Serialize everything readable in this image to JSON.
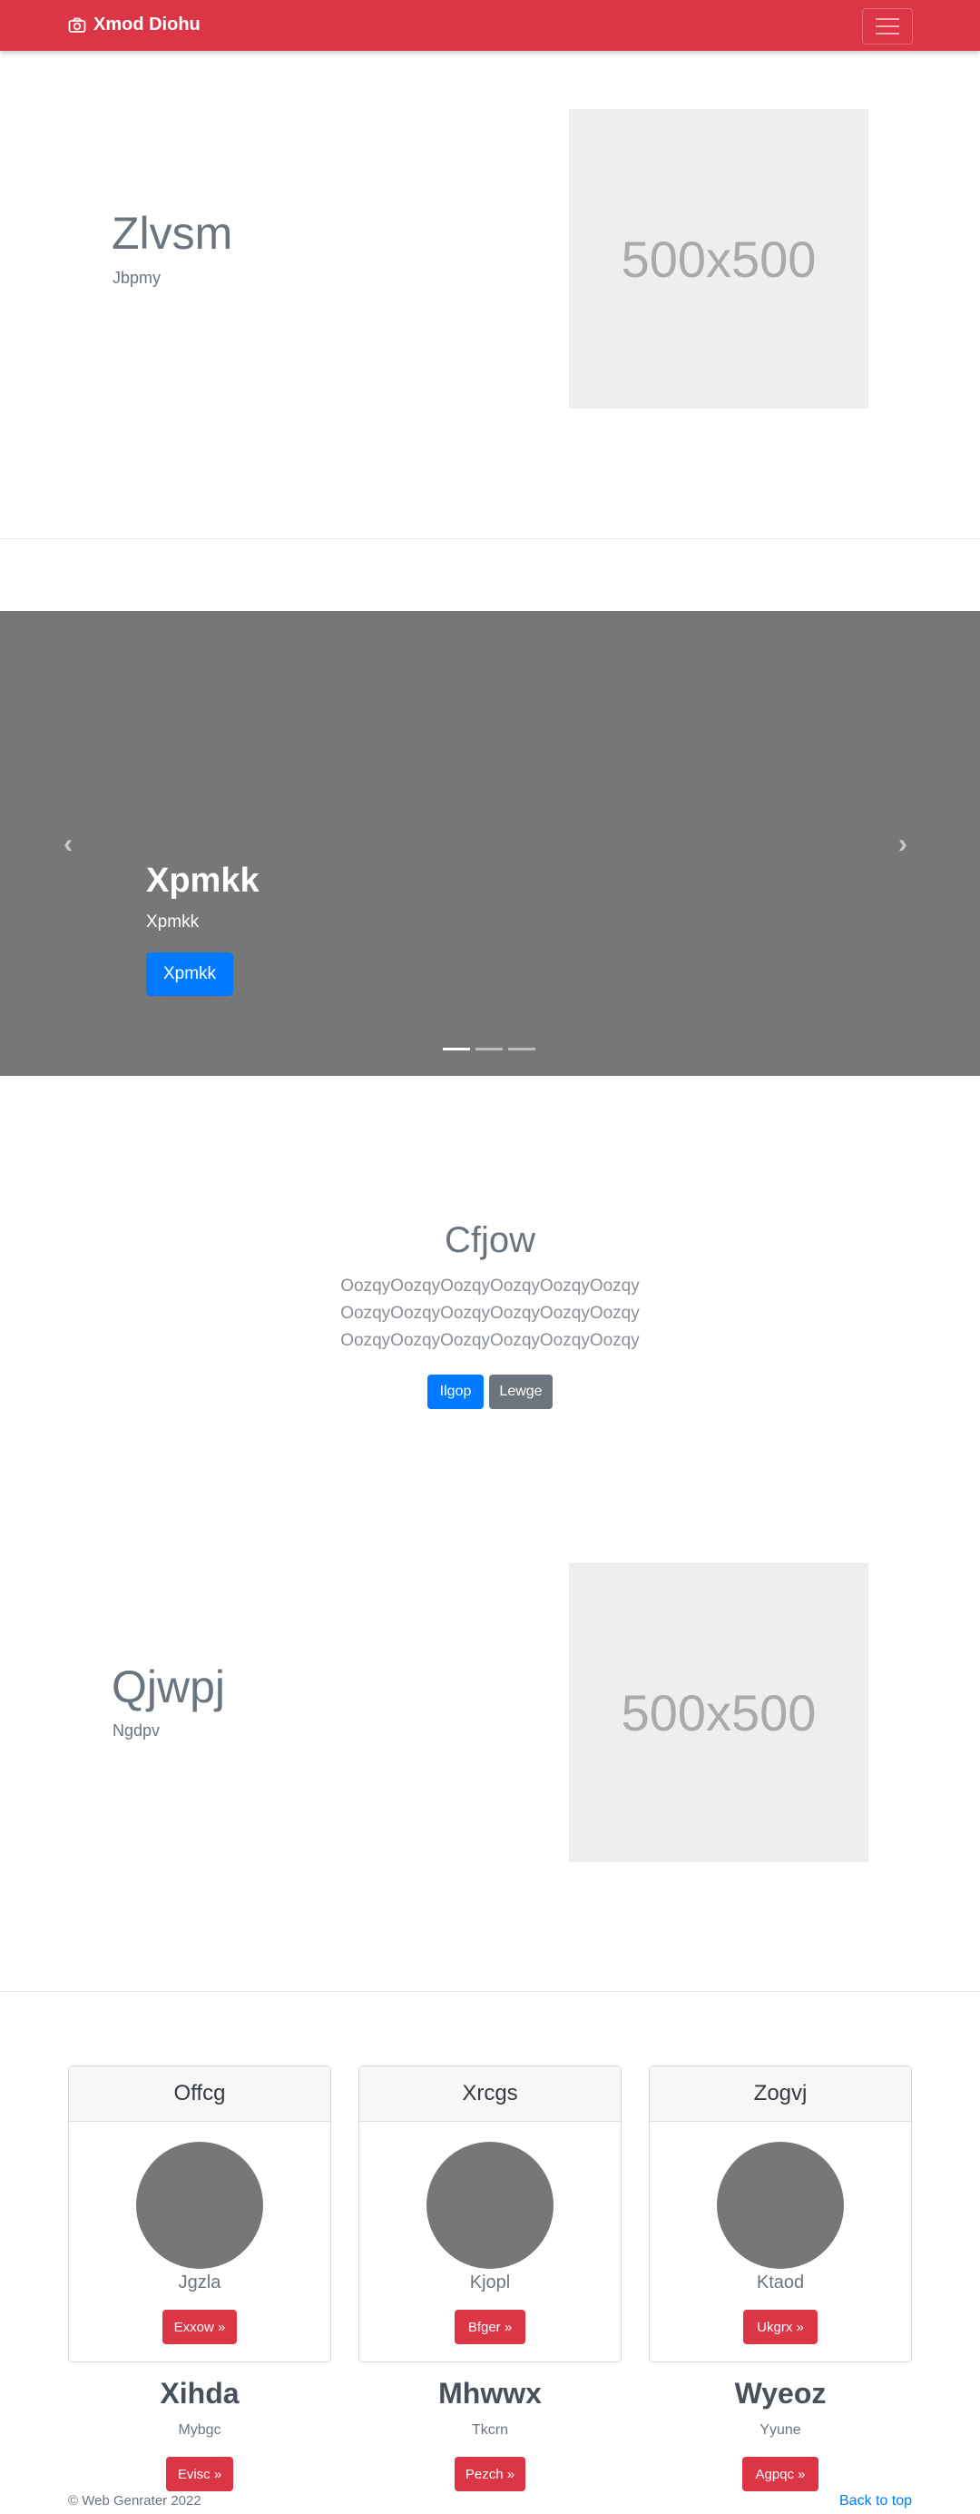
{
  "navbar": {
    "brand": "Xmod Diohu",
    "brand_icon": "camera-icon",
    "toggle_icon": "hamburger-icon",
    "color": "#dc3545"
  },
  "feature1": {
    "title": "Zlvsm",
    "subtitle": "Jbpmy",
    "image_label": "500x500"
  },
  "carousel": {
    "title": "Xpmkk",
    "text": "Xpmkk",
    "button": "Xpmkk",
    "prev_icon": "chevron-left-icon",
    "next_icon": "chevron-right-icon",
    "slide_count": 3,
    "active_slide": 1
  },
  "center": {
    "title": "Cfjow",
    "lines": [
      "OozqyOozqyOozqyOozqyOozqyOozqy",
      "OozqyOozqyOozqyOozqyOozqyOozqy",
      "OozqyOozqyOozqyOozqyOozqyOozqy"
    ],
    "primary_button": "Ilgop",
    "secondary_button": "Lewge"
  },
  "feature2": {
    "title": "Qjwpj",
    "subtitle": "Ngdpv",
    "image_label": "500x500"
  },
  "cards": [
    {
      "header": "Offcg",
      "name": "Jgzla",
      "button": "Exxow »"
    },
    {
      "header": "Xrcgs",
      "name": "Kjopl",
      "button": "Bfger »"
    },
    {
      "header": "Zogvj",
      "name": "Ktaod",
      "button": "Ukgrx »"
    }
  ],
  "columns": [
    {
      "title": "Xihda",
      "subtitle": "Mybgc",
      "button": "Evisc »"
    },
    {
      "title": "Mhwwx",
      "subtitle": "Tkcrn",
      "button": "Pezch »"
    },
    {
      "title": "Wyeoz",
      "subtitle": "Yyune",
      "button": "Agpqc »"
    }
  ],
  "footer": {
    "copyright": "© Web Genrater 2022",
    "back_to_top": "Back to top"
  }
}
